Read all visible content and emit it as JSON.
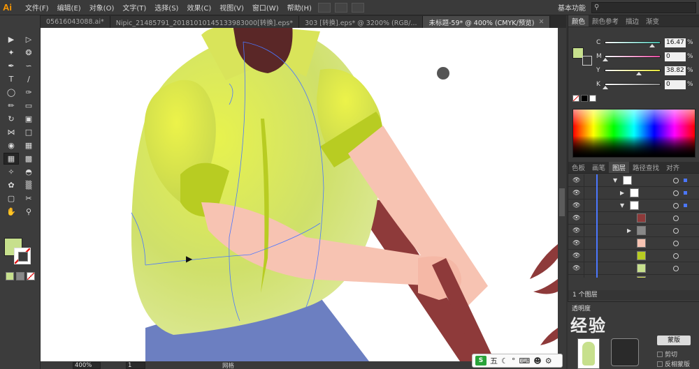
{
  "app": {
    "logo": "Ai"
  },
  "menu": [
    "文件(F)",
    "编辑(E)",
    "对象(O)",
    "文字(T)",
    "选择(S)",
    "效果(C)",
    "视图(V)",
    "窗口(W)",
    "帮助(H)"
  ],
  "workspace": "基本功能",
  "tabs": [
    {
      "label": "05616043088.ai*",
      "active": false
    },
    {
      "label": "Nipic_21485791_20181010145133983000[转换].eps*",
      "active": false
    },
    {
      "label": "303 [转换].eps* @ 3200% (RGB/...",
      "active": false
    },
    {
      "label": "未标题-59* @ 400% (CMYK/预览)",
      "active": true
    }
  ],
  "color_panel": {
    "tabs": [
      "颜色",
      "颜色参考",
      "描边",
      "渐变"
    ],
    "sliders": [
      {
        "label": "C",
        "value": "16.47",
        "pct": "%",
        "pos": 0.86,
        "color": "#45b8a8"
      },
      {
        "label": "M",
        "value": "0",
        "pct": "%",
        "pos": 0.0,
        "color": "#e44aa0"
      },
      {
        "label": "Y",
        "value": "38.82",
        "pct": "%",
        "pos": 0.62,
        "color": "#e6e63a"
      },
      {
        "label": "K",
        "value": "0",
        "pct": "%",
        "pos": 0.0,
        "color": "#888888"
      }
    ],
    "fill": "#c7e08d"
  },
  "layers_panel": {
    "tabs": [
      "色板",
      "画笔",
      "图层",
      "路径查找",
      "对齐"
    ],
    "footer": "1 个图层"
  },
  "status": {
    "zoom": "400%",
    "page": "1",
    "label": "网格"
  },
  "ime": {
    "logo": "S",
    "mode": "五"
  },
  "bottom_panel": {
    "title": "透明度",
    "watermark": "经验",
    "button": "蒙版",
    "check1": "剪切",
    "check2": "反相蒙版"
  }
}
